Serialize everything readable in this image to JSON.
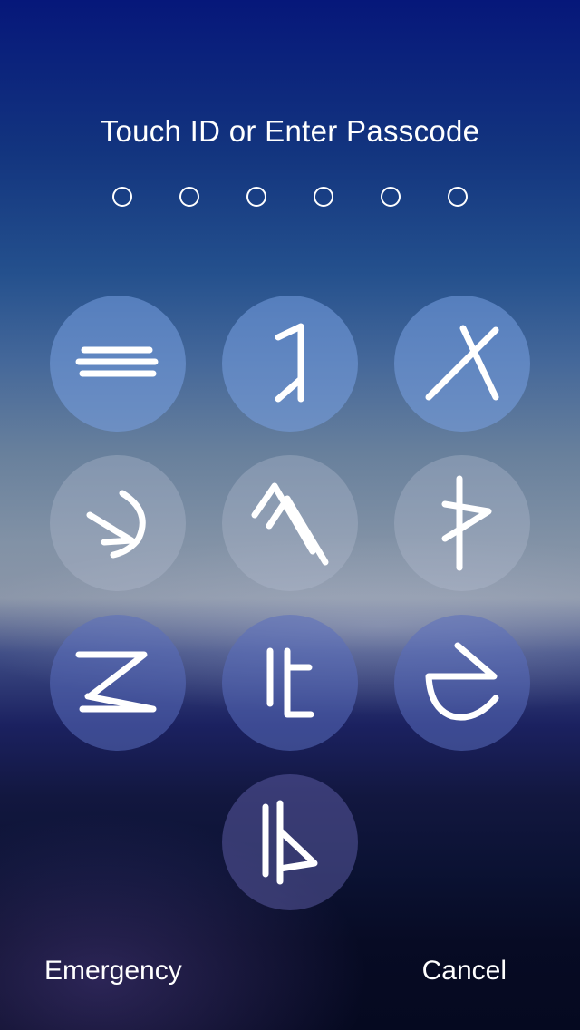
{
  "header": {
    "title": "Touch ID or Enter Passcode"
  },
  "passcode": {
    "length": 6,
    "entered": 0
  },
  "keypad": {
    "keys": [
      {
        "id": "key-1",
        "icon": "rune-triple-lines-icon"
      },
      {
        "id": "key-2",
        "icon": "rune-zigzag-icon"
      },
      {
        "id": "key-3",
        "icon": "rune-cross-icon"
      },
      {
        "id": "key-4",
        "icon": "rune-arc-arrow-icon"
      },
      {
        "id": "key-5",
        "icon": "rune-double-chevron-icon"
      },
      {
        "id": "key-6",
        "icon": "rune-thorn-icon"
      },
      {
        "id": "key-7",
        "icon": "rune-z-lines-icon"
      },
      {
        "id": "key-8",
        "icon": "rune-bar-corner-icon"
      },
      {
        "id": "key-9",
        "icon": "rune-curve-icon"
      },
      {
        "id": "key-0",
        "icon": "rune-bars-flag-icon"
      }
    ]
  },
  "footer": {
    "emergency_label": "Emergency",
    "cancel_label": "Cancel"
  }
}
